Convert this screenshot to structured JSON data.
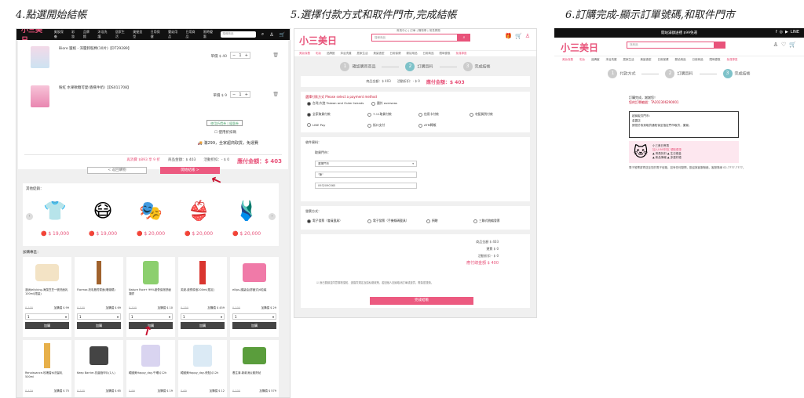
{
  "titles": {
    "step4": "4.點選開始結帳",
    "step5": "5.選擇付款方式和取件門市,完成結帳",
    "step6": "6.訂購完成-顯示訂單號碼,和取件門市"
  },
  "brand": {
    "name": "小三美日",
    "accent": "#e8537a",
    "primary_button": "#ec5a80"
  },
  "panel1": {
    "nav": [
      "美妝保養",
      "彩妝",
      "品牌館",
      "沐浴洗護",
      "居家生活",
      "美髮造型",
      "日用保健",
      "嬰幼用品",
      "日用商品",
      "限時優惠",
      "免運專區"
    ],
    "search_placeholder": "搜尋商品",
    "cart_items": [
      {
        "name": "Biore 蜜妮 - 深層卸粧棉(10片)【DT29289】",
        "price": "單價 $ 40",
        "qty": "1"
      },
      {
        "name": "粉紅 水果軟糖可愛(香蕉牛奶)【DS011708】",
        "price": "單價 $ 9",
        "qty": "1"
      }
    ],
    "coupon_button": "使用折價券 | 優惠券",
    "use_coupon": "使用折扣碼",
    "free_shipping": "滿299，全家超商取貨，免運費",
    "total_note": "再消費 $893 享 9 折",
    "subtotal": "商品金額：$ 403",
    "discount": "活動折扣：- $ 0",
    "total": "應付金額：$ 403",
    "btn_back": "< 返回購物",
    "btn_checkout": "開始結帳 >",
    "rec_label": "其他促銷：",
    "rec_prices": [
      "$ 19,000",
      "$ 19,000",
      "$ 20,000",
      "$ 20,000",
      "$ 20,000"
    ],
    "addon_label": "加購專區：",
    "addons": [
      {
        "name": "澳洲Jellyking-海藻豆豆一號洗面乳100ml(限量)",
        "old": "$ 100",
        "now": "加購價 $ 99",
        "qty": "1",
        "btn": "加購"
      },
      {
        "name": "Flormar-亮彩唇膏霧面(珊瑚橘)",
        "old": "$ 150",
        "now": "加購價 $ 69",
        "qty": "1",
        "btn": "加購"
      },
      {
        "name": "Nature Face+ 99%蘆薈保濕舒緩凝膠",
        "old": "$ 100",
        "now": "加購價 $ 10",
        "qty": "1",
        "btn": "加購"
      },
      {
        "name": "芙妮-蘆薈原液200ml(限定)",
        "old": "$ 150",
        "now": "加購價 $ 459",
        "qty": "1",
        "btn": "加購"
      },
      {
        "name": "ellips-護髮油(膠囊式)6粒裝",
        "old": "$ 100",
        "now": "加購價 $ 29",
        "qty": "1",
        "btn": "加購"
      },
      {
        "name": "Renaissance-玫瑰香水洗髮乳500ml",
        "old": "$ 419",
        "now": "加購價 $ 75"
      },
      {
        "name": "Keep Barrier-抗菌指甲片(1入)",
        "old": "$ 100",
        "now": "加購價 $ 65"
      },
      {
        "name": "韓國美Happy_day-午睡片12h",
        "old": "$ 99",
        "now": "加購價 $ 19"
      },
      {
        "name": "韓國美Happy_day-夜貼片12h",
        "old": "$ 69",
        "now": "加購價 $ 12"
      },
      {
        "name": "養生清-新款消炎散熱帖",
        "old": "$ 100",
        "now": "加購價 $ 579"
      }
    ]
  },
  "panel2": {
    "top_links": "會員中心 | 訂單 | 購物車 | 常見問題",
    "search_placeholder": "搜尋商品",
    "nav": [
      "美妝保養",
      "彩妝",
      "品牌館",
      "沐浴洗護",
      "居家生活",
      "美髮造型",
      "日用保健",
      "嬰幼用品",
      "日用商品",
      "限時優惠",
      "免運專區"
    ],
    "steps": [
      "確認購買商品",
      "訂購資料",
      "完成結帳"
    ],
    "step_numbers": [
      "1",
      "2",
      "3"
    ],
    "summary_subtotal": "商品金額：$ 403",
    "summary_discount": "活動折扣：- $ 0",
    "summary_total": "應付金額：$ 403",
    "payment_heading": "選擇付款方式 Please select a payment method",
    "region": [
      "台灣/大陸 Taiwan and Outer Islands",
      "國外 overseas"
    ],
    "payment_options": [
      "全家取貨付款",
      "7-11取貨付款",
      "信用卡付款",
      "宅配貨到付款",
      "LINE Pay",
      "街口支付",
      "ATM轉帳"
    ],
    "pickup_label": "收件資料：",
    "store_label": "取貨門市：",
    "store_value": "選擇門市",
    "name_value": "\"陳\"",
    "phone_value": "0932090365",
    "invoice_label": "發票方式：",
    "invoice_options": [
      "電子發票（會員載具）",
      "電子發票（手機條碼載具）",
      "捐贈",
      "三聯式統編發票"
    ],
    "totals": [
      "商品金額 $ 403",
      "運費 $ 0",
      "活動折扣 - $ 0",
      "應付總金額 $ 400"
    ],
    "agree_text": "我已閱讀並同意購物須知、退換貨規定及隱私權政策，若因個人因素取消訂單或退貨，需負擔運費。",
    "submit": "完成結帳"
  },
  "panel3": {
    "announcement": "開站滿額送禮 $99免運",
    "search_placeholder": "找商品",
    "nav": [
      "美妝保養",
      "彩妝",
      "品牌館",
      "沐浴洗護",
      "居家生活",
      "美髮造型",
      "日用保健",
      "嬰幼用品",
      "日用商品",
      "限時優惠",
      "免運專區"
    ],
    "steps": [
      "付款方式",
      "訂購資料",
      "完成結帳"
    ],
    "step_numbers": [
      "1",
      "2",
      "3"
    ],
    "done_title": "訂購完成，謝謝您！",
    "order_line": "您的訂單編號：TA202306290001",
    "store_title": "超商取貨門市：",
    "store_name": "金翼店",
    "store_note": "請您於收到取貨通知後至指定門市取貨，謝謝。",
    "banner_lines": [
      "小三美日會員",
      "加入LINE好友 領取優惠",
      "▲ 會員折扣  ▲ 生日禮金",
      "▲ 新品情報  ▲ 多重好禮"
    ],
    "note": "電子發票將寄送至您的電子信箱，如有任何疑問，歡迎與客服聯絡，客服專線 02-7777-7777。"
  }
}
